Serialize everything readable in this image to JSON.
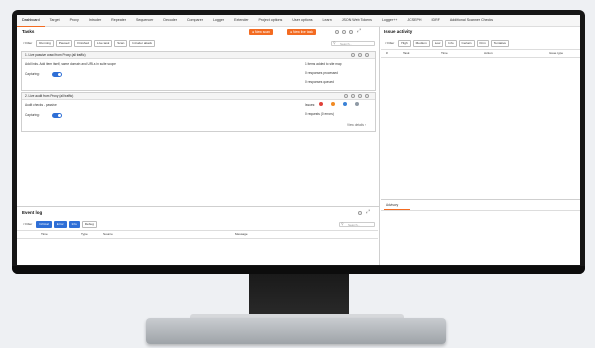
{
  "tabs": [
    "Dashboard",
    "Target",
    "Proxy",
    "Intruder",
    "Repeater",
    "Sequencer",
    "Decoder",
    "Comparer",
    "Logger",
    "Extender",
    "Project options",
    "User options",
    "Learn",
    "JSON Web Tokens",
    "Logger++",
    "JCSEPH",
    "IDRF",
    "Additional Scanner Checks"
  ],
  "tasks": {
    "title": "Tasks",
    "new_scan": "New scan",
    "new_live_task": "New live task",
    "filter_label": "Filter",
    "filters": [
      "Running",
      "Paused",
      "Finished",
      "Live task",
      "Scan",
      "Intruder attack"
    ],
    "search_placeholder": "Search...",
    "card1": {
      "title": "1. Live passive crawl from Proxy (all traffic)",
      "desc": "Add links. Add item itself, same domain and URLs in suite scope",
      "capturing": "Capturing:",
      "stat1": "1 items added to site map",
      "stat2": "0 responses processed",
      "stat3": "0 responses queued"
    },
    "card2": {
      "title": "2. Live audit from Proxy (all traffic)",
      "desc": "Audit checks - passive",
      "capturing": "Capturing:",
      "issues": "Issues:",
      "dots": [
        {
          "color": "#e0413a"
        },
        {
          "color": "#f08a24"
        },
        {
          "color": "#3b82d6"
        },
        {
          "color": "#8f9aa5"
        }
      ],
      "stat1": "0 requests (0 errors)",
      "view_details": "View details ›"
    }
  },
  "issue_activity": {
    "title": "Issue activity",
    "filter_label": "Filter",
    "filters": [
      "High",
      "Medium",
      "Low",
      "Info",
      "Certain",
      "Firm",
      "Tentative"
    ],
    "columns": [
      "#",
      "Task",
      "Time",
      "Action",
      "Issue type"
    ]
  },
  "advisory": {
    "tab": "Advisory"
  },
  "event_log": {
    "title": "Event log",
    "filter_label": "Filter",
    "filters": [
      "Critical",
      "Error",
      "Info",
      "Debug"
    ],
    "search_placeholder": "Search...",
    "columns": [
      "Time",
      "Type",
      "Source",
      "Message"
    ]
  },
  "colors": {
    "accent": "#f36b21",
    "blue": "#2f6fd6"
  }
}
